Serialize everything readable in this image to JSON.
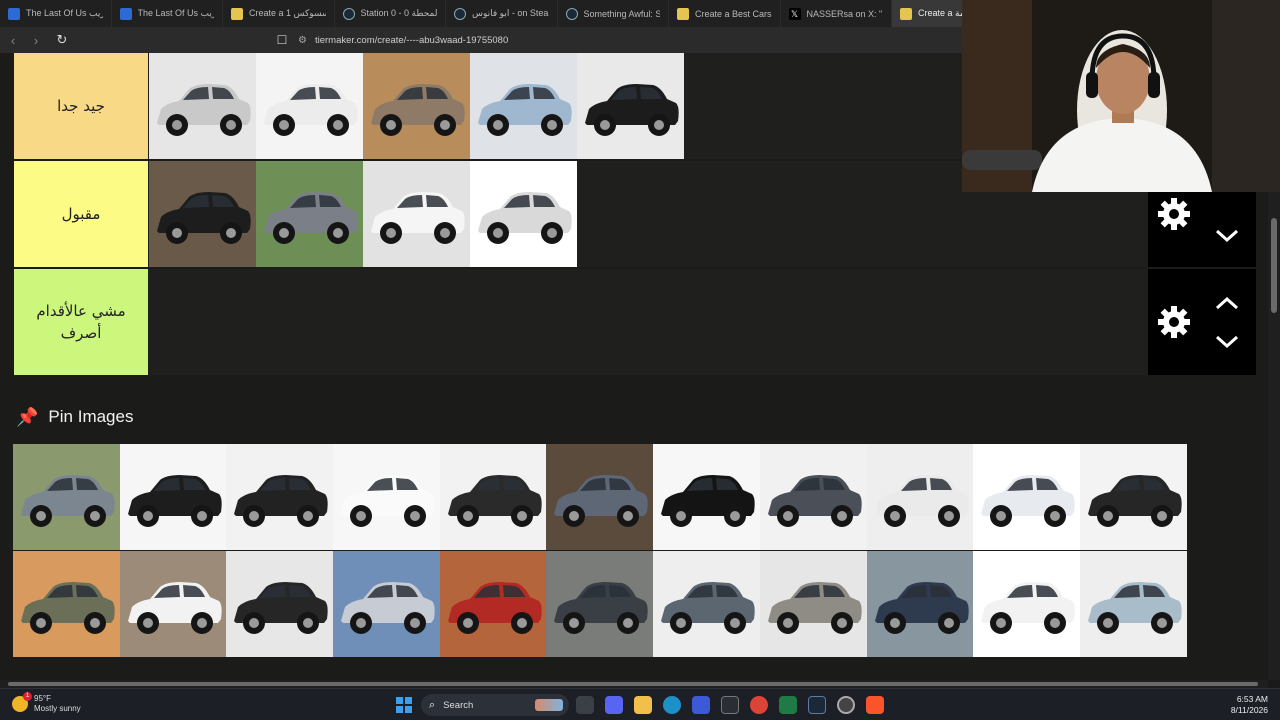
{
  "browser": {
    "tabs": [
      {
        "label": "The Last Of Us تعريب",
        "icon": "edge-icon",
        "active": false
      },
      {
        "label": "The Last Of Us تعريب",
        "icon": "edge-icon",
        "active": false
      },
      {
        "label": "Create a الاكسسوكس 1",
        "icon": "tiermaker-icon",
        "active": false
      },
      {
        "label": "Station 0 - 0 المحطة",
        "icon": "steam-icon",
        "active": false
      },
      {
        "label": "ابو فانوس - on Steam",
        "icon": "steam-icon",
        "active": false
      },
      {
        "label": "Something Awful: Str",
        "icon": "steam-icon",
        "active": false
      },
      {
        "label": "Create a Best Cars Tie",
        "icon": "tiermaker-icon",
        "active": false
      },
      {
        "label": "NASSERsa on X: \"@3",
        "icon": "x-icon",
        "active": false
      },
      {
        "label": "Create a قيمة",
        "icon": "tiermaker-icon",
        "active": true
      }
    ],
    "url": "tiermaker.com/create/----abu3waad-19755080"
  },
  "tiers": [
    {
      "label": "جيد جدا",
      "color": "#f8d985",
      "cars": [
        {
          "bg": "#e6e6e6",
          "body": "#c9c9c9"
        },
        {
          "bg": "#f4f4f4",
          "body": "#ececec"
        },
        {
          "bg": "#b88d5b",
          "body": "#8e7a66"
        },
        {
          "bg": "#dfe3e8",
          "body": "#9fb7cf"
        },
        {
          "bg": "#e9e9e9",
          "body": "#1c1c1c"
        }
      ]
    },
    {
      "label": "مقبول",
      "color": "#fbfb86",
      "cars": [
        {
          "bg": "#6a5a49",
          "body": "#1d1d1d"
        },
        {
          "bg": "#6e8f55",
          "body": "#7b8088"
        },
        {
          "bg": "#e2e2e2",
          "body": "#f5f5f5"
        },
        {
          "bg": "#ffffff",
          "body": "#d9d9d9"
        }
      ]
    },
    {
      "label": "مشي عالأقدام أصرف",
      "color": "#cdf77c",
      "cars": []
    }
  ],
  "pin_heading": "Pin Images",
  "pool": [
    {
      "bg": "#8b9a6e",
      "body": "#7c8690"
    },
    {
      "bg": "#f6f6f6",
      "body": "#1d1d1d"
    },
    {
      "bg": "#f2f2f2",
      "body": "#222222"
    },
    {
      "bg": "#f7f7f7",
      "body": "#fafafa"
    },
    {
      "bg": "#f2f2f2",
      "body": "#2a2a2a"
    },
    {
      "bg": "#5b4b3d",
      "body": "#5d6775"
    },
    {
      "bg": "#f7f7f7",
      "body": "#141414"
    },
    {
      "bg": "#f1f1f1",
      "body": "#4b5058"
    },
    {
      "bg": "#eeeeee",
      "body": "#eaeaea"
    },
    {
      "bg": "#ffffff",
      "body": "#e7ebf0"
    },
    {
      "bg": "#f3f3f3",
      "body": "#262626"
    },
    {
      "bg": "#d89a5e",
      "body": "#6b6f57"
    },
    {
      "bg": "#9c8b78",
      "body": "#f2f2f2"
    },
    {
      "bg": "#e7e7e7",
      "body": "#262626"
    },
    {
      "bg": "#6f8fb9",
      "body": "#c7cbd4"
    },
    {
      "bg": "#b5653c",
      "body": "#b32a24"
    },
    {
      "bg": "#7a7c79",
      "body": "#3a3f45"
    },
    {
      "bg": "#eeeeee",
      "body": "#5b6670"
    },
    {
      "bg": "#e6e6e6",
      "body": "#8e8c84"
    },
    {
      "bg": "#8896a0",
      "body": "#2e3a4d"
    },
    {
      "bg": "#ffffff",
      "body": "#f2f2f2"
    },
    {
      "bg": "#eeeeee",
      "body": "#a9bcc9"
    }
  ],
  "taskbar": {
    "temperature": "95°F",
    "condition": "Mostly sunny",
    "search_placeholder": "Search",
    "time": "6:53 AM",
    "date": "8/11/2026",
    "notification_count": "1"
  }
}
